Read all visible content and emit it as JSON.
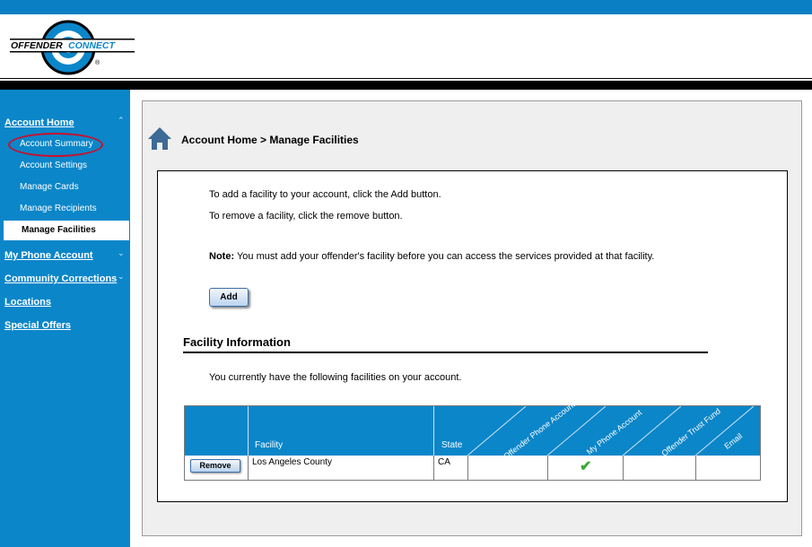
{
  "brand": {
    "logo_text": "OFFENDERCONNECT",
    "accent": "#0b86c9",
    "highlight": "#c8102e"
  },
  "sidebar": {
    "account_home": "Account Home",
    "sub_items": [
      "Account Summary",
      "Account Settings",
      "Manage Cards",
      "Manage Recipients",
      "Manage Facilities"
    ],
    "active": "Manage Facilities",
    "my_phone_account": "My Phone Account",
    "community_corrections": "Community Corrections",
    "locations": "Locations",
    "special_offers": "Special Offers"
  },
  "page": {
    "breadcrumb": "Account Home > Manage Facilities",
    "line1": "To add a facility to your account, click the Add button.",
    "line2": "To remove a facility, click the remove button.",
    "note_label": "Note:",
    "note_text": " You must add your offender's facility before you can access the services provided at that facility.",
    "add_label": "Add",
    "section_title": "Facility Information",
    "section_desc": "You currently have the following facilities on your account."
  },
  "table": {
    "columns": [
      "Facility",
      "State",
      "Offender Phone Account",
      "My Phone Account",
      "Offender Trust Fund",
      "Email"
    ],
    "rows": [
      {
        "action": "Remove",
        "facility": "Los Angeles County",
        "state": "CA",
        "offender_phone_account": "",
        "my_phone_account": "✔",
        "offender_trust_fund": "",
        "email": ""
      }
    ]
  }
}
